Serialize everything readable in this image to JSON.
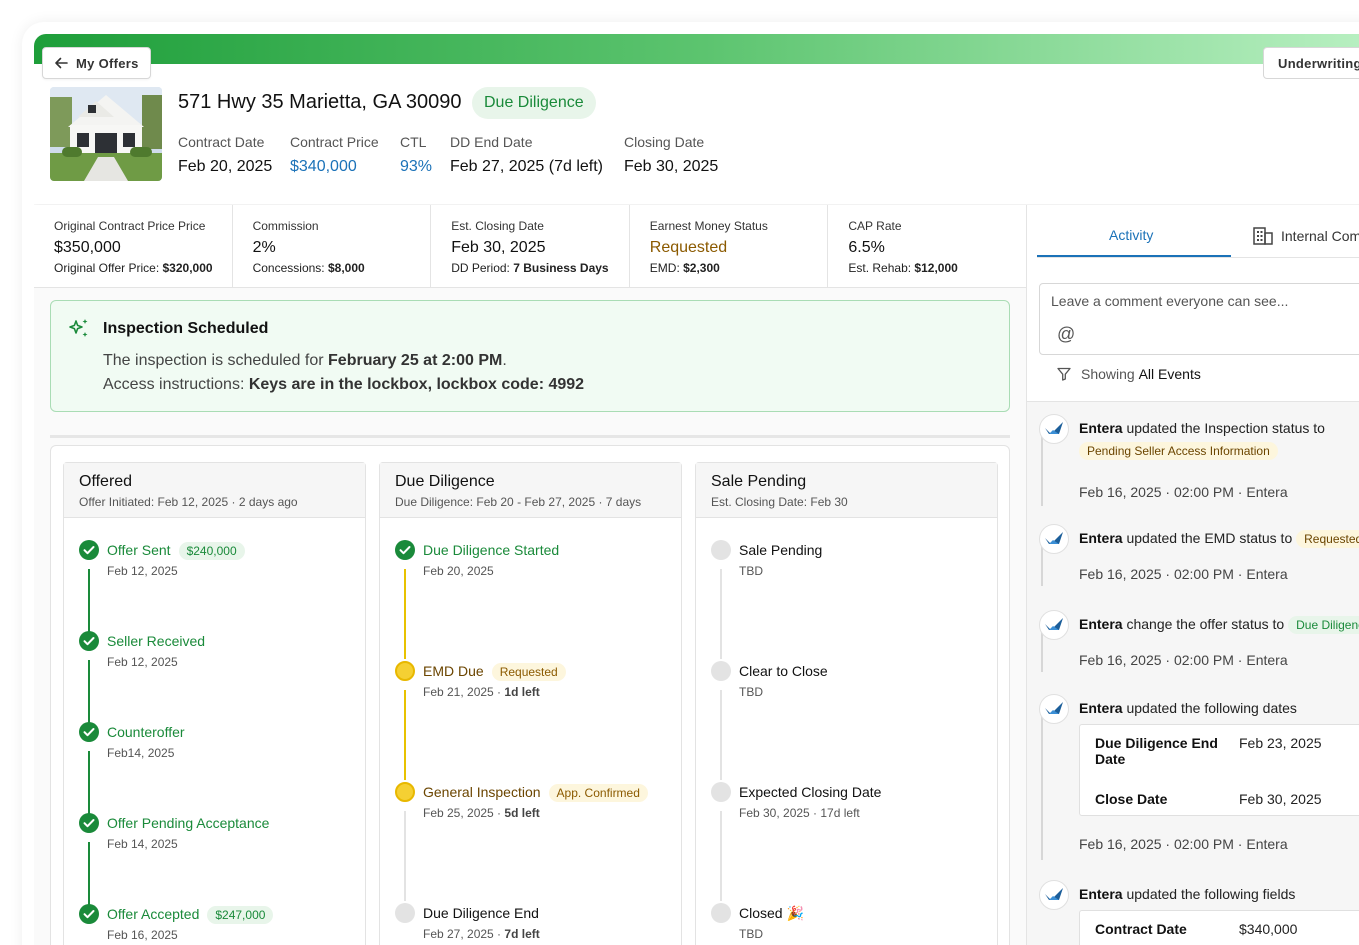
{
  "nav": {
    "back_label": "My Offers",
    "underwriting_label": "Underwriting"
  },
  "property": {
    "address": "571 Hwy 35 Marietta, GA 30090",
    "stage": "Due Diligence",
    "contract_date_label": "Contract Date",
    "contract_date": "Feb 20, 2025",
    "contract_price_label": "Contract Price",
    "contract_price": "$340,000",
    "ctl_label": "CTL",
    "ctl": "93%",
    "dd_end_label": "DD End Date",
    "dd_end": "Feb 27, 2025 (7d left)",
    "closing_label": "Closing Date",
    "closing": "Feb 30, 2025"
  },
  "metrics": [
    {
      "label": "Original Contract Price Price",
      "value": "$350,000",
      "sub_label": "Original Offer Price:",
      "sub_value": "$320,000"
    },
    {
      "label": "Commission",
      "value": "2%",
      "sub_label": "Concessions:",
      "sub_value": "$8,000"
    },
    {
      "label": "Est. Closing Date",
      "value": "Feb 30, 2025",
      "sub_label": "DD Period:",
      "sub_value": "7 Business Days"
    },
    {
      "label": "Earnest Money Status",
      "value": "Requested",
      "sub_label": "EMD:",
      "sub_value": "$2,300"
    },
    {
      "label": "CAP Rate",
      "value": "6.5%",
      "sub_label": "Est. Rehab:",
      "sub_value": "$12,000"
    }
  ],
  "alert": {
    "title": "Inspection Scheduled",
    "line1_prefix": "The inspection is scheduled for ",
    "line1_bold": "February 25 at 2:00 PM",
    "line1_suffix": ".",
    "line2_prefix": "Access instructions: ",
    "line2_bold": "Keys are in the lockbox, lockbox code: 4992"
  },
  "columns": {
    "offered": {
      "title": "Offered",
      "subtitle": "Offer Initiated: Feb 12, 2025 · 2 days ago",
      "steps": [
        {
          "title": "Offer Sent",
          "pill": "$240,000",
          "date": "Feb 12, 2025"
        },
        {
          "title": "Seller Received",
          "date": "Feb 12, 2025"
        },
        {
          "title": "Counteroffer",
          "date": "Feb14, 2025"
        },
        {
          "title": "Offer Pending Acceptance",
          "date": "Feb 14, 2025"
        },
        {
          "title": "Offer Accepted",
          "pill": "$247,000",
          "date": "Feb 16, 2025"
        }
      ]
    },
    "due_diligence": {
      "title": "Due Diligence",
      "subtitle": "Due Diligence: Feb 20 - Feb 27, 2025 · 7 days",
      "steps": [
        {
          "title": "Due Diligence Started",
          "date": "Feb 20, 2025"
        },
        {
          "title": "EMD Due",
          "pill": "Requested",
          "date": "Feb 21, 2025 · ",
          "date_bold": "1d left"
        },
        {
          "title": "General Inspection",
          "pill": "App. Confirmed",
          "date": "Feb 25, 2025 · ",
          "date_bold": "5d left"
        },
        {
          "title": "Due Diligence End",
          "date": "Feb 27, 2025 · ",
          "date_bold": "7d left"
        }
      ]
    },
    "sale_pending": {
      "title": "Sale Pending",
      "subtitle": "Est. Closing Date: Feb 30",
      "steps": [
        {
          "title": "Sale Pending",
          "date": "TBD"
        },
        {
          "title": "Clear to Close",
          "date": "TBD"
        },
        {
          "title": "Expected Closing Date",
          "date": "Feb 30, 2025 · 17d left"
        },
        {
          "title": "Closed",
          "emoji": "🎉",
          "date": "TBD"
        }
      ]
    }
  },
  "activity": {
    "tab_activity": "Activity",
    "tab_internal": "Internal Com",
    "comment_placeholder": "Leave a comment everyone can see...",
    "at_symbol": "@",
    "filter_prefix": "Showing",
    "filter_value": "All Events",
    "events": [
      {
        "actor": "Entera",
        "action": " updated the Inspection status to",
        "pill": "Pending Seller Access Information",
        "date": "Feb 16, 2025",
        "time": "02:00 PM",
        "by": "Entera"
      },
      {
        "actor": "Entera",
        "action": " updated the EMD status to",
        "pill": "Requested",
        "date": "Feb 16, 2025",
        "time": "02:00 PM",
        "by": "Entera"
      },
      {
        "actor": "Entera",
        "action": " change the offer status to",
        "pill": "Due Diligence",
        "date": "Feb 16, 2025",
        "time": "02:00 PM",
        "by": "Entera"
      },
      {
        "actor": "Entera",
        "action": " updated the following dates",
        "rows": [
          {
            "k1": "Due Diligence End",
            "k2": "Date",
            "v": "Feb 23, 2025"
          },
          {
            "k1": "Close Date",
            "v": "Feb 30, 2025"
          }
        ],
        "date": "Feb 16, 2025",
        "time": "02:00 PM",
        "by": "Entera"
      },
      {
        "actor": "Entera",
        "action": " updated the following fields",
        "rows": [
          {
            "k1": "Contract Date",
            "v": "$340,000"
          }
        ]
      }
    ],
    "sep": "·"
  },
  "colors": {
    "brand_green": "#1a8a3a",
    "link_blue": "#1b72b8",
    "warn_yellow": "#f5d033"
  }
}
